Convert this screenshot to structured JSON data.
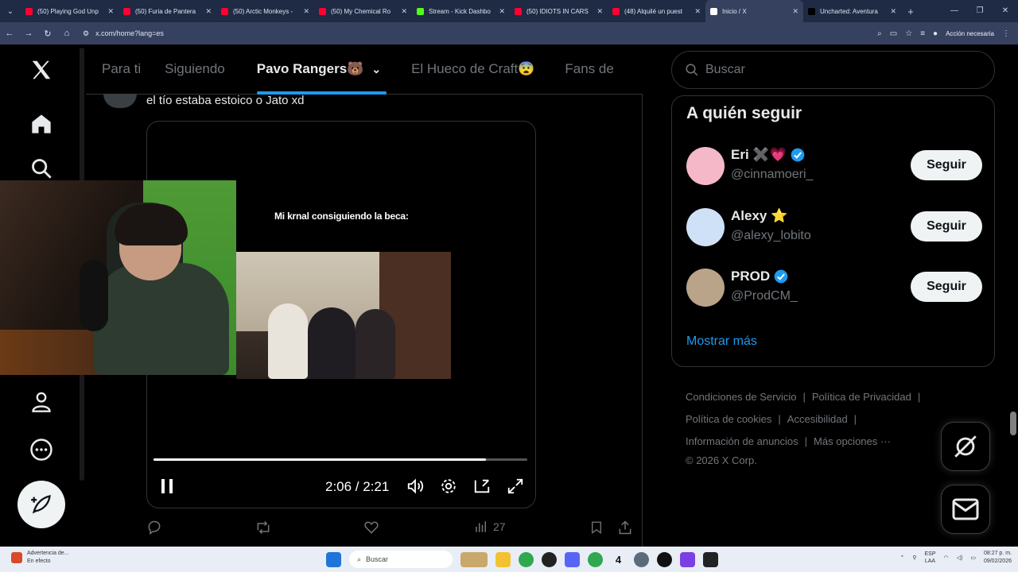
{
  "browser": {
    "tabs": [
      {
        "label": "(50) Playing God Unp",
        "color": "#ff0033"
      },
      {
        "label": "(50) Furia de Pantera",
        "color": "#ff0033"
      },
      {
        "label": "(50) Arctic Monkeys -",
        "color": "#ff0033"
      },
      {
        "label": "(50) My Chemical Ro",
        "color": "#ff0033"
      },
      {
        "label": "Stream - Kick Dashbo",
        "color": "#53fc18"
      },
      {
        "label": "(50) IDIOTS IN CARS",
        "color": "#ff0033"
      },
      {
        "label": "(48) Alquilé un puest",
        "color": "#ff0033"
      },
      {
        "label": "Inicio / X",
        "color": "#ffffff"
      },
      {
        "label": "Uncharted: Aventura",
        "color": "#000000"
      }
    ],
    "url": "x.com/home?lang=es",
    "action_label": "Acción necesaria"
  },
  "feed": {
    "tabs": [
      "Para ti",
      "Siguiendo",
      "Pavo Rangers🐻",
      "El Hueco de Craft😨",
      "Fans de"
    ],
    "active_tab_index": 2,
    "tweet_text": "el tío estaba estoico o Jato xd",
    "video": {
      "caption": "Mi krnal consiguiendo la beca:",
      "time": "2:06 / 2:21",
      "progress": 0.89
    },
    "views": "27"
  },
  "sidebar": {
    "search_placeholder": "Buscar",
    "who_to_follow_title": "A quién seguir",
    "users": [
      {
        "name": "Eri ✖️💗",
        "handle": "@cinnamoeri_",
        "verified": true,
        "avatar_color": "#f4b8c8",
        "button": "Seguir"
      },
      {
        "name": "Alexy ⭐",
        "handle": "@alexy_lobito",
        "verified": false,
        "avatar_color": "#cfe1f7",
        "button": "Seguir"
      },
      {
        "name": "PROD",
        "handle": "@ProdCM_",
        "verified": true,
        "avatar_color": "#b9a48a",
        "button": "Seguir"
      }
    ],
    "show_more": "Mostrar más",
    "footer": {
      "links_row1": [
        "Condiciones de Servicio",
        "Política de Privacidad"
      ],
      "links_row2": [
        "Política de cookies",
        "Accesibilidad"
      ],
      "links_row3": [
        "Información de anuncios",
        "Más opciones ···"
      ],
      "copyright": "© 2026 X Corp."
    }
  },
  "taskbar": {
    "weather_title": "Advertencia de...",
    "weather_sub": "En efecto",
    "search": "Buscar",
    "lang_top": "ESP",
    "lang_bottom": "LAA",
    "time": "08:27 p. m.",
    "date": "09/02/2026"
  }
}
